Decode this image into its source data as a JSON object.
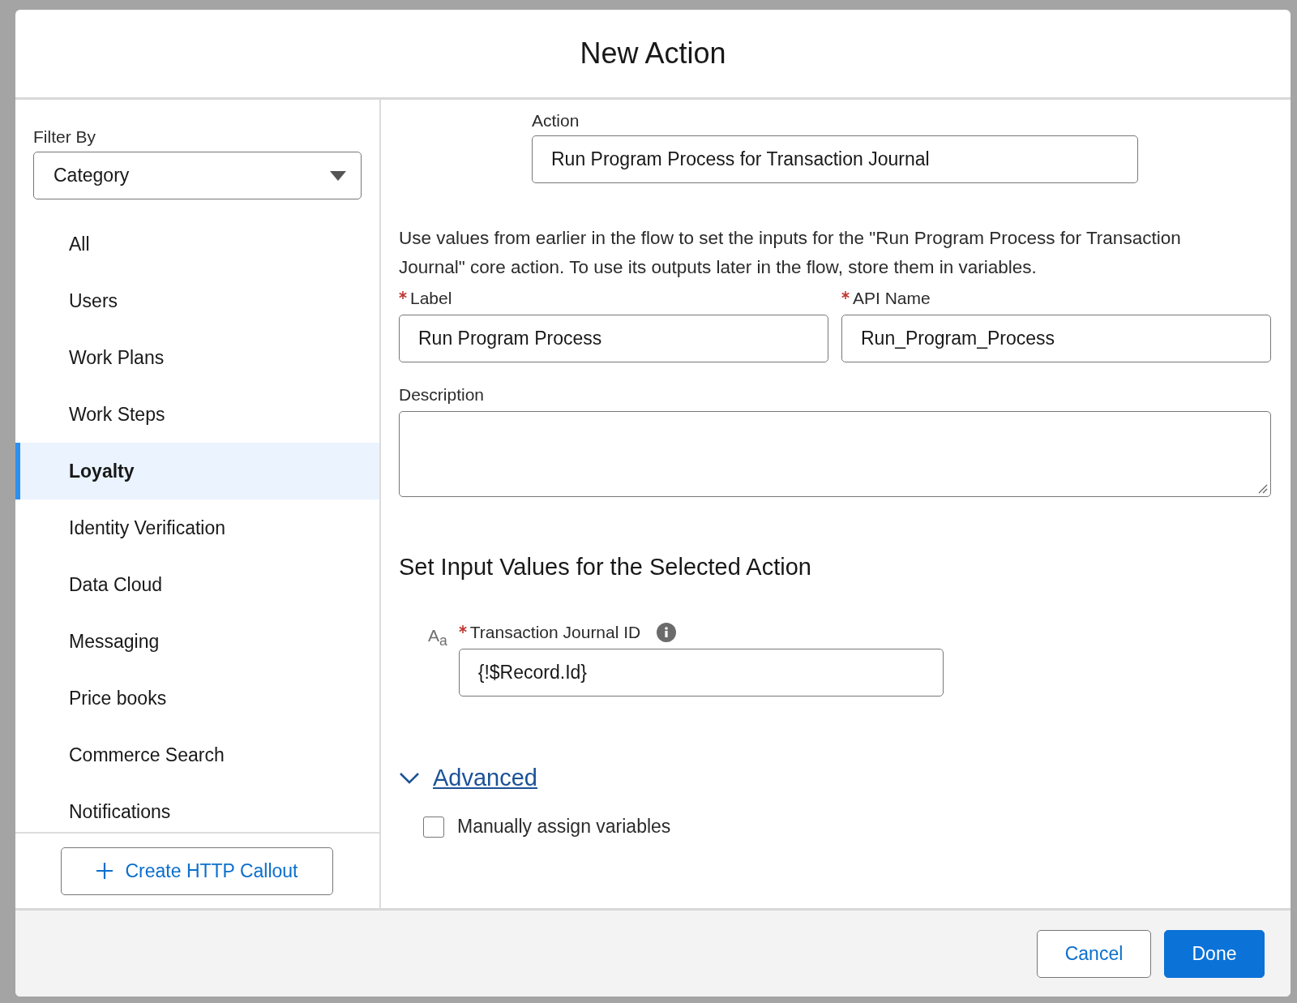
{
  "dialog": {
    "title": "New Action"
  },
  "filter": {
    "label": "Filter By",
    "value": "Category"
  },
  "categories": [
    {
      "label": "All",
      "selected": false
    },
    {
      "label": "Users",
      "selected": false
    },
    {
      "label": "Work Plans",
      "selected": false
    },
    {
      "label": "Work Steps",
      "selected": false
    },
    {
      "label": "Loyalty",
      "selected": true
    },
    {
      "label": "Identity Verification",
      "selected": false
    },
    {
      "label": "Data Cloud",
      "selected": false
    },
    {
      "label": "Messaging",
      "selected": false
    },
    {
      "label": "Price books",
      "selected": false
    },
    {
      "label": "Commerce Search",
      "selected": false
    },
    {
      "label": "Notifications",
      "selected": false
    }
  ],
  "create_button": {
    "label": "Create HTTP Callout"
  },
  "action": {
    "label": "Action",
    "value": "Run Program Process for Transaction Journal"
  },
  "intro": "Use values from earlier in the flow to set the inputs for the \"Run Program Process for Transaction Journal\" core action. To use its outputs later in the flow, store them in variables.",
  "fields": [
    {
      "label": "Label",
      "required": true,
      "value": "Run Program Process"
    },
    {
      "label": "API Name",
      "required": true,
      "value": "Run_Program_Process"
    }
  ],
  "description": {
    "label": "Description"
  },
  "inputs_heading": "Set Input Values for the Selected Action",
  "input_values": [
    {
      "type_icon": "A$_{a}$",
      "label": "Transaction Journal ID",
      "required": true,
      "value": "{!$Record.Id}"
    }
  ],
  "advanced": {
    "label": "Advanced",
    "expanded": true
  },
  "options": [
    {
      "label": "Manually assign variables",
      "checked": false
    }
  ],
  "buttons": [
    {
      "label": "Cancel",
      "kind": "neutral"
    },
    {
      "label": "Done",
      "kind": "brand"
    }
  ]
}
